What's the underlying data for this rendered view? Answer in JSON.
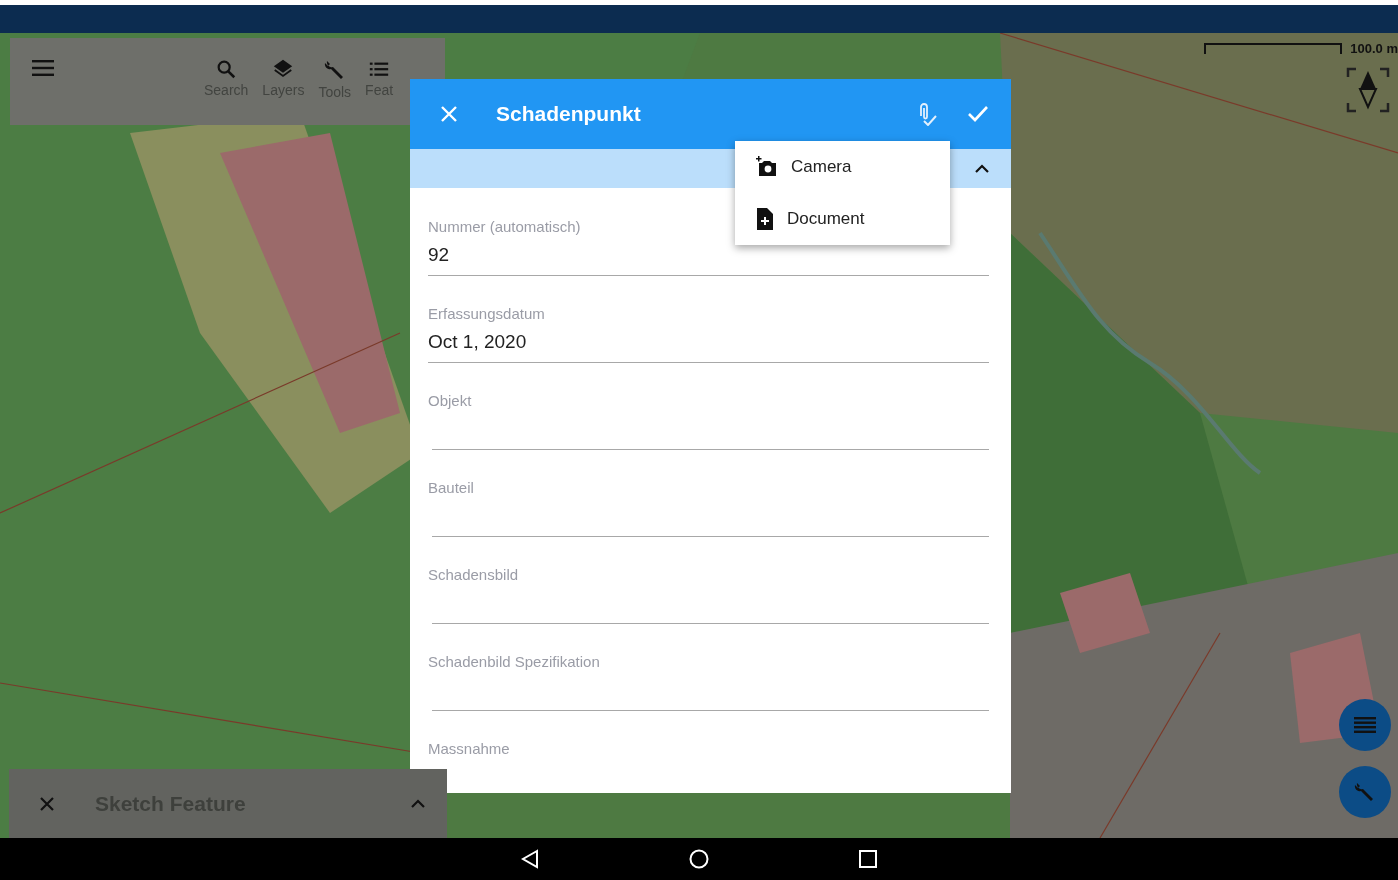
{
  "toolbar": {
    "items": [
      {
        "kind": "search",
        "label": "Search"
      },
      {
        "kind": "layers",
        "label": "Layers"
      },
      {
        "kind": "tools",
        "label": "Tools"
      },
      {
        "kind": "features",
        "label": "Feat"
      }
    ]
  },
  "scale": {
    "label": "100.0 m"
  },
  "dialog": {
    "title": "Schadenpunkt",
    "fields": [
      {
        "label": "Nummer (automatisch)",
        "value": "92"
      },
      {
        "label": "Erfassungsdatum",
        "value": "Oct 1, 2020"
      },
      {
        "label": "Objekt"
      },
      {
        "label": "Bauteil"
      },
      {
        "label": "Schadensbild"
      },
      {
        "label": "Schadenbild Spezifikation"
      },
      {
        "label": "Massnahme"
      }
    ]
  },
  "attach_menu": [
    {
      "kind": "camera",
      "label": "Camera"
    },
    {
      "kind": "document",
      "label": "Document"
    }
  ],
  "sketch_bar": {
    "title": "Sketch Feature"
  }
}
